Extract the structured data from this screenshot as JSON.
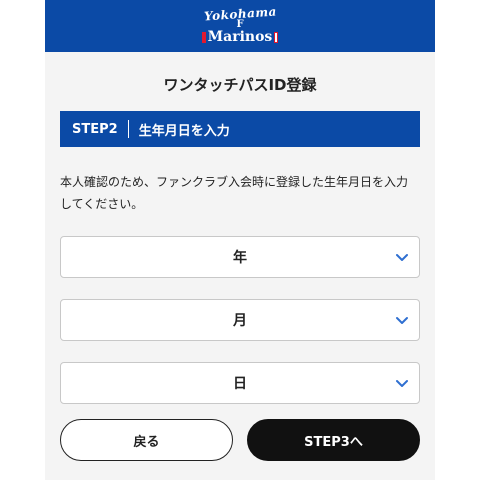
{
  "header": {
    "logo_top": "Yokohama",
    "logo_mid": "F",
    "logo_bottom": "Marinos"
  },
  "page_title": "ワンタッチパスID登録",
  "step": {
    "number": "STEP2",
    "label": "生年月日を入力"
  },
  "description": "本人確認のため、ファンクラブ入会時に登録した生年月日を入力してください。",
  "selects": {
    "year": "年",
    "month": "月",
    "day": "日"
  },
  "buttons": {
    "back": "戻る",
    "next": "STEP3へ"
  },
  "colors": {
    "brand_blue": "#0b4aa6",
    "chevron_blue": "#2f6fd1",
    "logo_red": "#e0192f"
  },
  "icons": {
    "select_chevron": "chevron-down-icon"
  }
}
